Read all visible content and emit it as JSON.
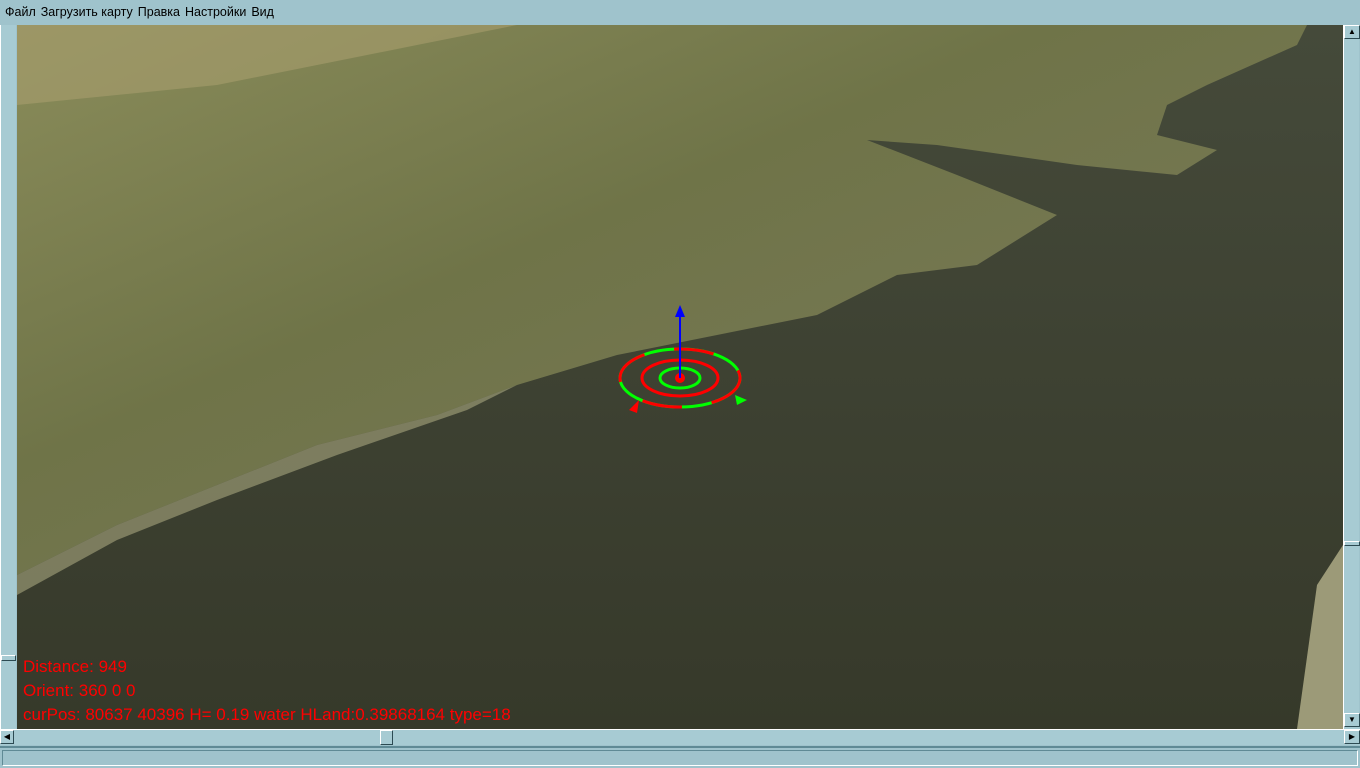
{
  "menu": [
    "Файл",
    "Загрузить карту",
    "Правка",
    "Настройки",
    "Вид"
  ],
  "overlay": {
    "distance": "Distance: 949",
    "orient": "Orient: 360 0 0",
    "curpos": "curPos: 80637 40396 H= 0.19 water HLand:0.39868164 type=18"
  },
  "colors": {
    "overlay_text": "#ff0000",
    "chrome": "#9fc3cc",
    "water": "#3a3d2c"
  }
}
